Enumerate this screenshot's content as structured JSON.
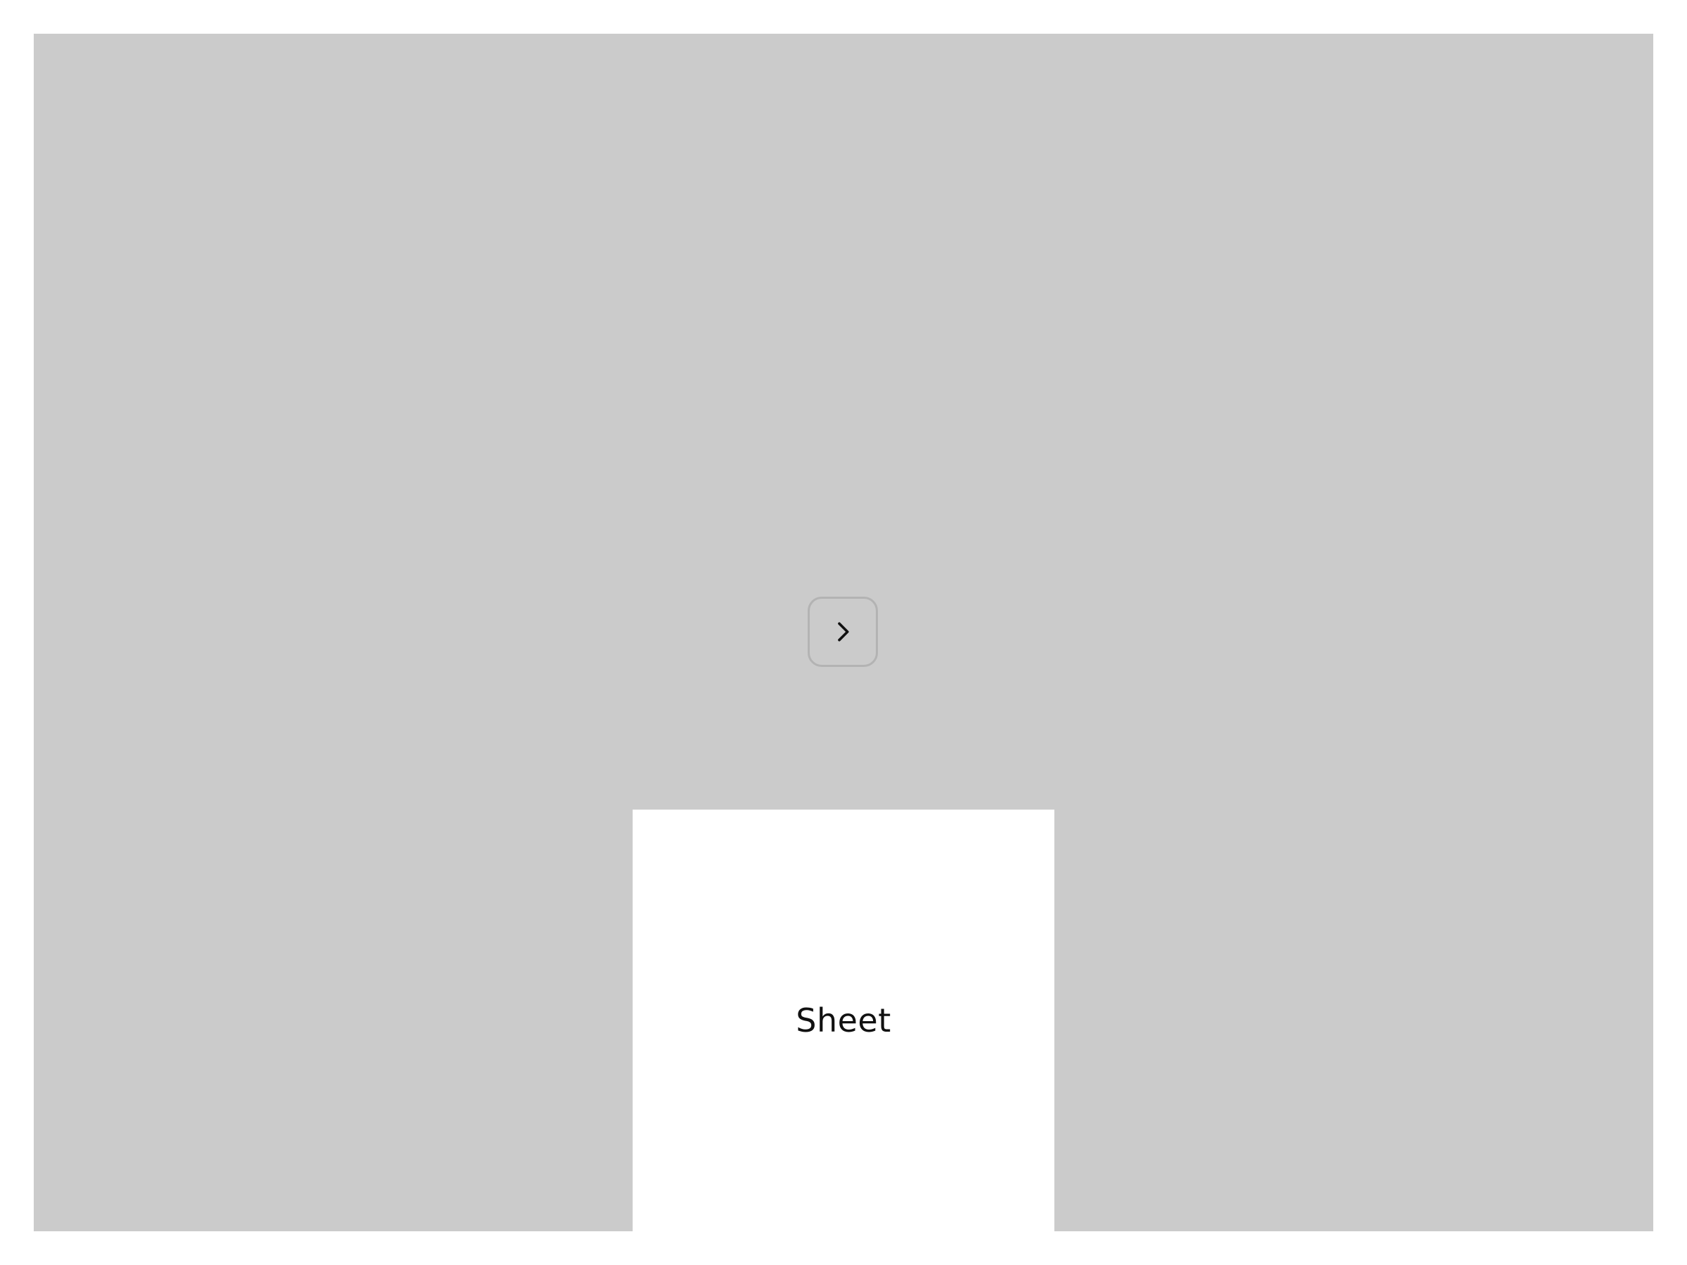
{
  "colors": {
    "page_background": "#ffffff",
    "backdrop": "#cbcbcb",
    "sheet_background": "#ffffff",
    "button_border": "#b3b3b3",
    "icon": "#111111"
  },
  "trigger_button": {
    "icon": "chevron-right-icon"
  },
  "sheet": {
    "label": "Sheet"
  }
}
